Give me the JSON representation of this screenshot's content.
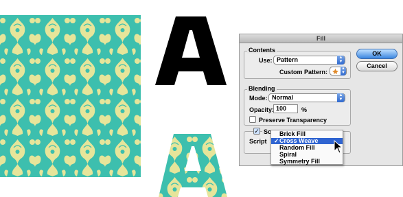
{
  "dialog": {
    "title": "Fill",
    "contents": {
      "title": "Contents",
      "use_label": "Use:",
      "use_value": "Pattern",
      "custom_pattern_label": "Custom Pattern:"
    },
    "blending": {
      "title": "Blending",
      "mode_label": "Mode:",
      "mode_value": "Normal",
      "opacity_label": "Opacity:",
      "opacity_value": "100",
      "opacity_unit": "%",
      "preserve_label": "Preserve Transparency",
      "preserve_checked": false
    },
    "scripted": {
      "checkbox_label": "Scr",
      "script_label": "Script",
      "checked": true
    },
    "ok_label": "OK",
    "cancel_label": "Cancel"
  },
  "script_menu": {
    "items": [
      {
        "label": "Brick Fill",
        "selected": false
      },
      {
        "label": "Cross Weave",
        "selected": true
      },
      {
        "label": "Random Fill",
        "selected": false
      },
      {
        "label": "Spiral",
        "selected": false
      },
      {
        "label": "Symmetry Fill",
        "selected": false
      }
    ],
    "check_glyph": "✓"
  },
  "colors": {
    "pattern_bg": "#3dbfae",
    "pattern_fg": "#e6e59a",
    "letter_black": "#000000",
    "selection_blue": "#2f64d1",
    "ok_button": "#3b86e0"
  },
  "icons": {
    "popup_arrows": "up-down-arrows-icon",
    "pattern_swatch": "pattern-swatch-icon",
    "cursor": "arrow-cursor-icon"
  }
}
